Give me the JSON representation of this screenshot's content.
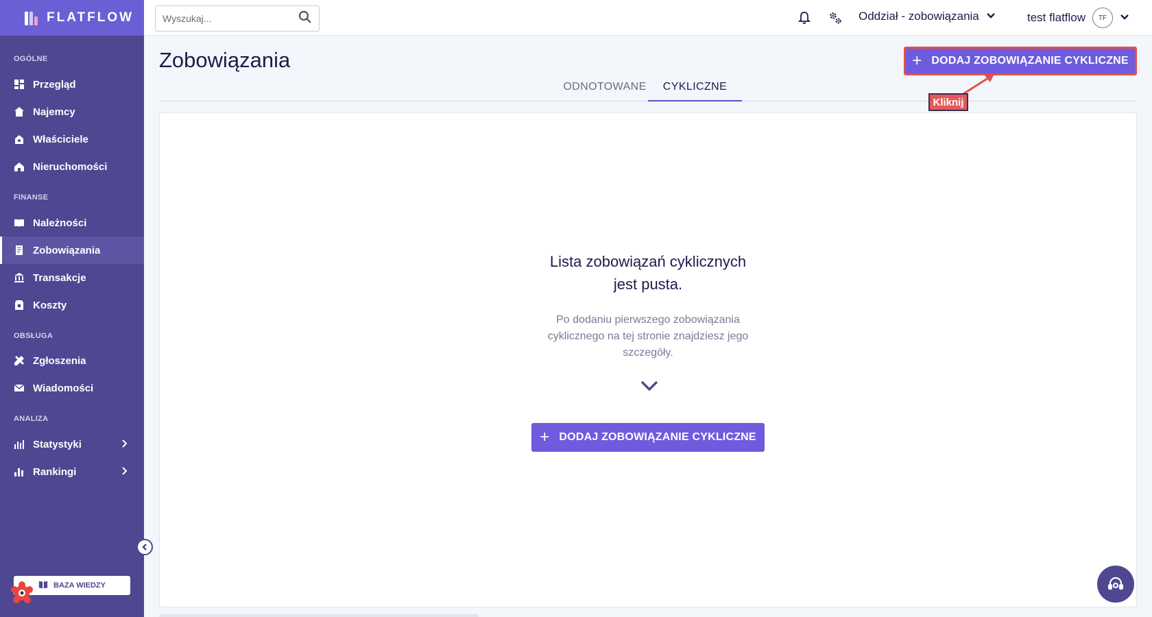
{
  "brand": {
    "name": "FLATFLOW"
  },
  "sidebar": {
    "sections": [
      {
        "label": "OGÓLNE",
        "items": [
          {
            "label": "Przegląd",
            "icon": "dashboard-icon"
          },
          {
            "label": "Najemcy",
            "icon": "tenants-icon"
          },
          {
            "label": "Właściciele",
            "icon": "owners-icon"
          },
          {
            "label": "Nieruchomości",
            "icon": "properties-icon"
          }
        ]
      },
      {
        "label": "FINANSE",
        "items": [
          {
            "label": "Należności",
            "icon": "receivables-icon"
          },
          {
            "label": "Zobowiązania",
            "icon": "liabilities-icon",
            "active": true
          },
          {
            "label": "Transakcje",
            "icon": "bank-icon"
          },
          {
            "label": "Koszty",
            "icon": "costs-icon"
          }
        ]
      },
      {
        "label": "OBSŁUGA",
        "items": [
          {
            "label": "Zgłoszenia",
            "icon": "tools-icon"
          },
          {
            "label": "Wiadomości",
            "icon": "mail-icon"
          }
        ]
      },
      {
        "label": "ANALIZA",
        "items": [
          {
            "label": "Statystyki",
            "icon": "stats-icon",
            "expandable": true
          },
          {
            "label": "Rankingi",
            "icon": "ranking-icon",
            "expandable": true
          }
        ]
      }
    ],
    "knowledge_base": "BAZA WIEDZY"
  },
  "topbar": {
    "search_placeholder": "Wyszukaj...",
    "branch": "Oddział - zobowiązania",
    "user_name": "test flatflow",
    "user_initials": "TF"
  },
  "main": {
    "title": "Zobowiązania",
    "add_button": "DODAJ ZOBOWIĄZANIE CYKLICZNE",
    "tabs": [
      {
        "label": "ODNOTOWANE",
        "active": false
      },
      {
        "label": "CYKLICZNE",
        "active": true
      }
    ],
    "annotation": "Kliknij",
    "empty_title_line1": "Lista zobowiązań cyklicznych",
    "empty_title_line2": "jest pusta.",
    "empty_desc_line1": "Po dodaniu pierwszego zobowiązania",
    "empty_desc_line2": "cyklicznego na tej stronie znajdziesz jego",
    "empty_desc_line3": "szczegóły.",
    "empty_button": "DODAJ ZOBOWIĄZANIE CYKLICZNE"
  },
  "colors": {
    "sidebar_bg": "#4f4791",
    "brand_bg": "#6b5fd6",
    "accent": "#6e5bde",
    "highlight": "#e0514a"
  }
}
